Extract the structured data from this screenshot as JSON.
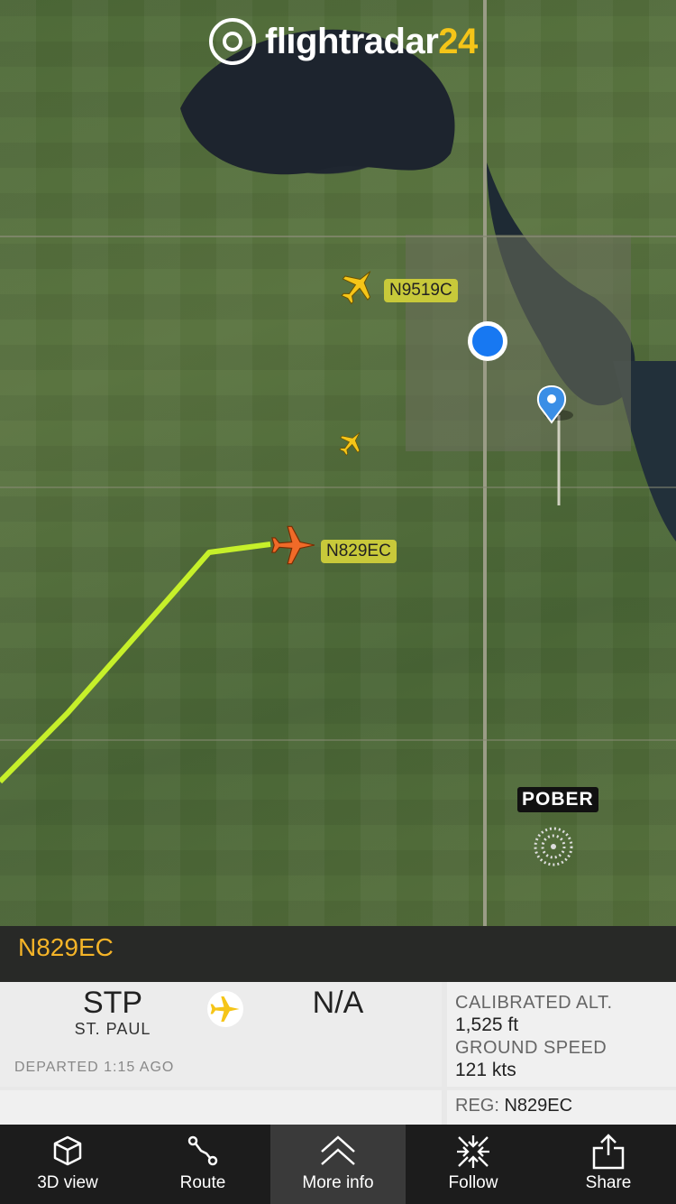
{
  "app": {
    "brand": "flightradar",
    "brand_num": "24",
    "accent": "#f5c518"
  },
  "map": {
    "aircraft_labels": [
      "N9519C",
      "N829EC"
    ],
    "waypoint": "POBER",
    "track_color": "#c6f02a",
    "selected_plane_color": "#f06a28",
    "other_plane_color": "#f5c518"
  },
  "flight": {
    "callsign": "N829EC",
    "origin_code": "STP",
    "origin_city": "ST. PAUL",
    "destination_code": "N/A",
    "departed": "DEPARTED 1:15 AGO",
    "calibrated_alt_label": "CALIBRATED ALT.",
    "calibrated_alt_value": "1,525 ft",
    "ground_speed_label": "GROUND SPEED",
    "ground_speed_value": "121 kts",
    "reg_label": "REG:",
    "reg_value": "N829EC"
  },
  "toolbar": {
    "items": [
      {
        "label": "3D view",
        "icon": "cube-icon"
      },
      {
        "label": "Route",
        "icon": "route-icon"
      },
      {
        "label": "More info",
        "icon": "chevron-up-icon"
      },
      {
        "label": "Follow",
        "icon": "follow-icon"
      },
      {
        "label": "Share",
        "icon": "share-icon"
      }
    ]
  }
}
